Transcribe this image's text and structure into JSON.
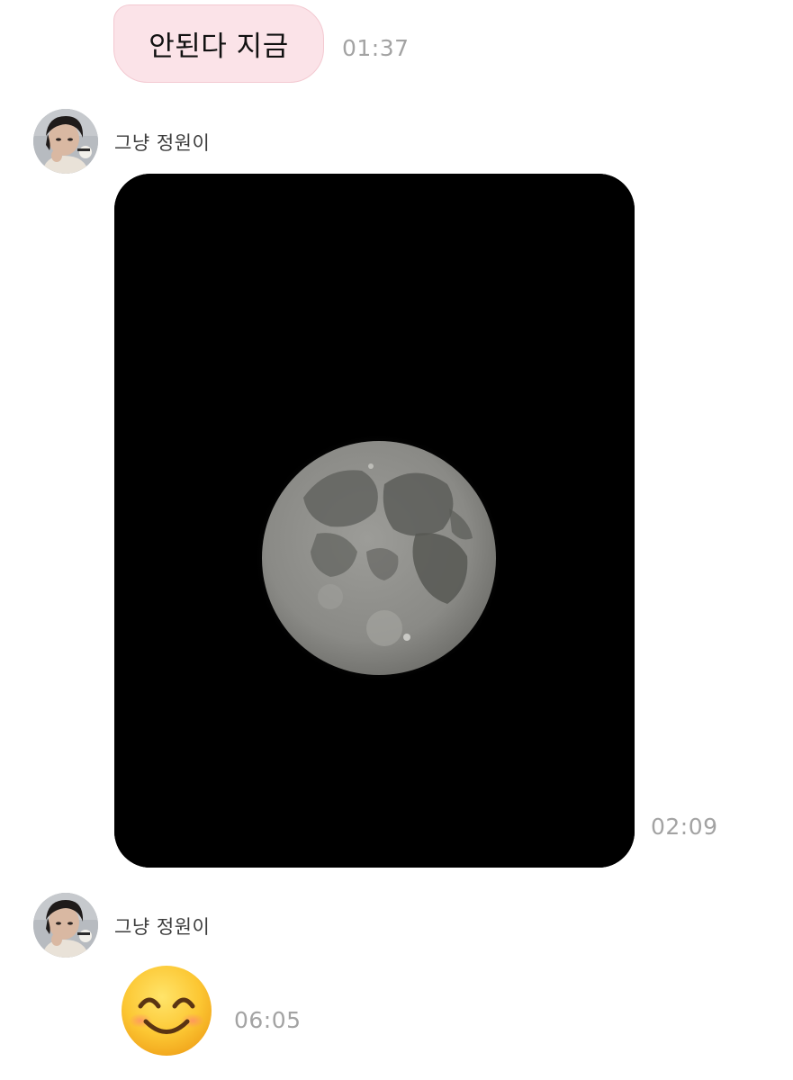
{
  "messages": [
    {
      "direction": "outgoing",
      "type": "text",
      "text": "안된다 지금",
      "time": "01:37"
    },
    {
      "direction": "incoming",
      "type": "image",
      "sender": "그냥 정원이",
      "image_icon": "full-moon-photo",
      "time": "02:09"
    },
    {
      "direction": "incoming",
      "type": "emoji",
      "sender": "그냥 정원이",
      "emoji_icon": "smiling-face-emoji",
      "time": "06:05"
    }
  ],
  "colors": {
    "outgoing_bubble": "#fbe3e8",
    "outgoing_border": "#f3c9d1",
    "timestamp": "#a3a3a3",
    "sender_name": "#3c3c3c"
  }
}
